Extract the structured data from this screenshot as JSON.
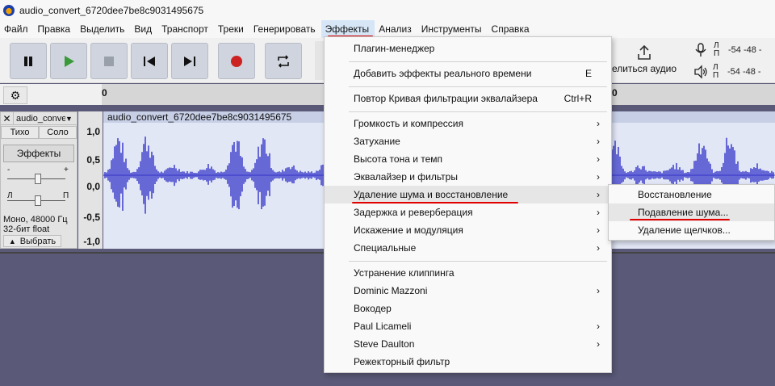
{
  "window": {
    "title": "audio_convert_6720dee7be8c9031495675",
    "logo_icon": "audacity-logo-icon"
  },
  "menubar": [
    "Файл",
    "Правка",
    "Выделить",
    "Вид",
    "Транспорт",
    "Треки",
    "Генерировать",
    "Эффекты",
    "Анализ",
    "Инструменты",
    "Справка"
  ],
  "toolbar": {
    "share_label": "елиться аудио",
    "meter": {
      "l": "Л",
      "r": "П",
      "scale": "-54  -48  -"
    }
  },
  "ruler": {
    "left_label": "0",
    "right_label": "0"
  },
  "track": {
    "name": "audio_conve",
    "mute": "Тихо",
    "solo": "Соло",
    "effects": "Эффекты",
    "gain_minus": "-",
    "gain_plus": "+",
    "pan_left": "Л",
    "pan_right": "П",
    "info_line1": "Моно, 48000 Гц",
    "info_line2": "32-бит float",
    "select": "Выбрать",
    "scale": [
      "1,0",
      "0,5",
      "0,0",
      "-0,5",
      "-1,0"
    ],
    "clip_name": "audio_convert_6720dee7be8c9031495675"
  },
  "effects_menu": {
    "items": [
      {
        "label": "Плагин-менеджер",
        "shortcut": "",
        "arrow": false
      },
      {
        "label": "Добавить эффекты реального времени",
        "shortcut": "E",
        "arrow": false
      },
      {
        "label": "Повтор Кривая фильтрации эквалайзера",
        "shortcut": "Ctrl+R",
        "arrow": false
      },
      {
        "label": "Громкость и компрессия",
        "shortcut": "",
        "arrow": true
      },
      {
        "label": "Затухание",
        "shortcut": "",
        "arrow": true
      },
      {
        "label": "Высота тона и темп",
        "shortcut": "",
        "arrow": true
      },
      {
        "label": "Эквалайзер и фильтры",
        "shortcut": "",
        "arrow": true
      },
      {
        "label": "Удаление шума и восстановление",
        "shortcut": "",
        "arrow": true
      },
      {
        "label": "Задержка и реверберация",
        "shortcut": "",
        "arrow": true
      },
      {
        "label": "Искажение и модуляция",
        "shortcut": "",
        "arrow": true
      },
      {
        "label": "Специальные",
        "shortcut": "",
        "arrow": true
      },
      {
        "label": "Устранение клиппинга",
        "shortcut": "",
        "arrow": false
      },
      {
        "label": "Dominic Mazzoni",
        "shortcut": "",
        "arrow": true
      },
      {
        "label": "Вокодер",
        "shortcut": "",
        "arrow": false
      },
      {
        "label": "Paul Licameli",
        "shortcut": "",
        "arrow": true
      },
      {
        "label": "Steve Daulton",
        "shortcut": "",
        "arrow": true
      },
      {
        "label": "Режекторный фильтр",
        "shortcut": "",
        "arrow": false
      }
    ]
  },
  "noise_submenu": {
    "items": [
      "Восстановление",
      "Подавление шума...",
      "Удаление щелчков..."
    ]
  },
  "colors": {
    "waveform": "#3232c8",
    "waveform_bg": "#e2e7f6",
    "highlight_underline": "#e00000",
    "play_green": "#3a9a3a",
    "record_red": "#cc2222"
  }
}
